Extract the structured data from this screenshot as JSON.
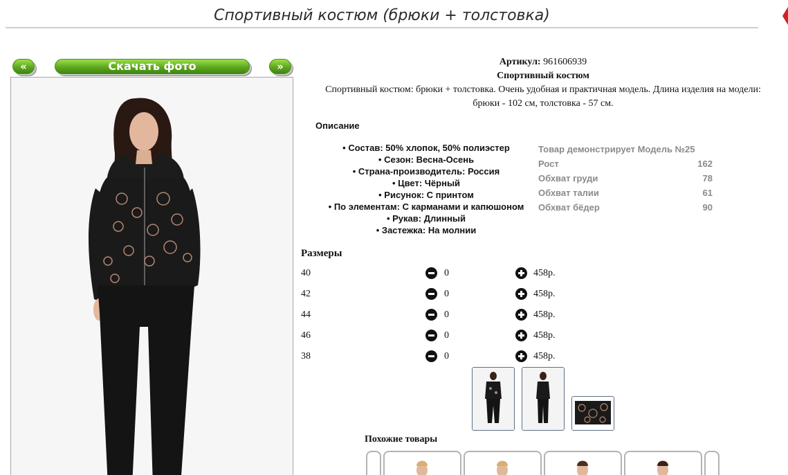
{
  "page": {
    "title": "Спортивный костюм (брюки + толстовка)"
  },
  "gallery": {
    "prev_label": "«",
    "download_label": "Скачать фото",
    "next_label": "»"
  },
  "product": {
    "article_label": "Артикул:",
    "article_value": "961606939",
    "name": "Спортивный костюм",
    "description": "Спортивный костюм: брюки + толстовка. Очень удобная и практичная модель. Длина изделия на модели: брюки - 102 см, толстовка - 57 см."
  },
  "description_section": {
    "heading": "Описание",
    "properties": [
      "Состав: 50% хлопок, 50% полиэстер",
      "Сезон: Весна-Осень",
      "Страна-производитель: Россия",
      "Цвет: Чёрный",
      "Рисунок: С принтом",
      "По элементам: С карманами и капюшоном",
      "Рукав: Длинный",
      "Застежка: На молнии"
    ]
  },
  "model": {
    "header": "Товар демонстрирует Модель №25",
    "rows": [
      {
        "label": "Рост",
        "value": "162"
      },
      {
        "label": "Обхват груди",
        "value": "78"
      },
      {
        "label": "Обхват талии",
        "value": "61"
      },
      {
        "label": "Обхват бёдер",
        "value": "90"
      }
    ]
  },
  "sizes": {
    "heading": "Размеры",
    "rows": [
      {
        "size": "40",
        "qty": "0",
        "price": "458р."
      },
      {
        "size": "42",
        "qty": "0",
        "price": "458р."
      },
      {
        "size": "44",
        "qty": "0",
        "price": "458р."
      },
      {
        "size": "46",
        "qty": "0",
        "price": "458р."
      },
      {
        "size": "38",
        "qty": "0",
        "price": "458р."
      }
    ]
  },
  "similar": {
    "heading": "Похожие товары"
  },
  "icons": {
    "minus": "minus-circle-icon",
    "plus": "plus-circle-icon"
  },
  "colors": {
    "button_green": "#5ea81e",
    "model_text": "#8a8a8a",
    "thumb_border": "#5b6e86"
  }
}
